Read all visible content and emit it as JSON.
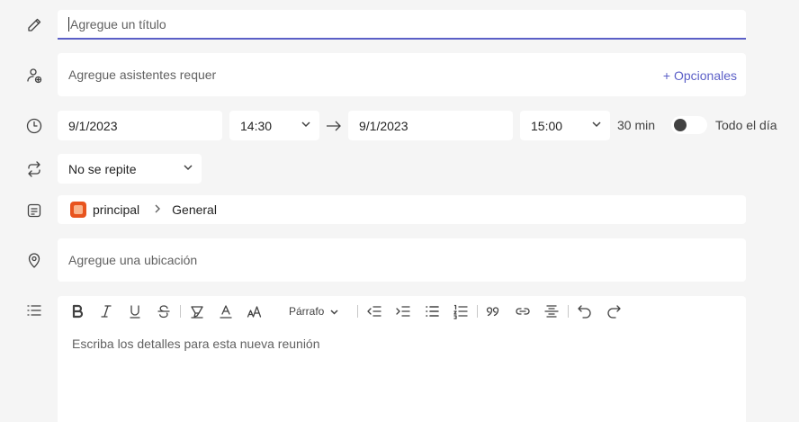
{
  "title": {
    "placeholder": "Agregue un título"
  },
  "attendees": {
    "placeholder": "Agregue asistentes requer",
    "optional_link": "+ Opcionales"
  },
  "schedule": {
    "start_date": "9/1/2023",
    "start_time": "14:30",
    "end_date": "9/1/2023",
    "end_time": "15:00",
    "duration": "30 min",
    "all_day_label": "Todo el día",
    "all_day": false
  },
  "repeat": {
    "value": "No se repite"
  },
  "channel": {
    "team": "principal",
    "channel": "General",
    "team_color": "#e8541e"
  },
  "location": {
    "placeholder": "Agregue una ubicación"
  },
  "editor": {
    "paragraph_label": "Párrafo",
    "placeholder": "Escriba los detalles para esta nueva reunión"
  },
  "colors": {
    "accent": "#5b5fc7",
    "background": "#f5f5f5",
    "field": "#ffffff"
  }
}
